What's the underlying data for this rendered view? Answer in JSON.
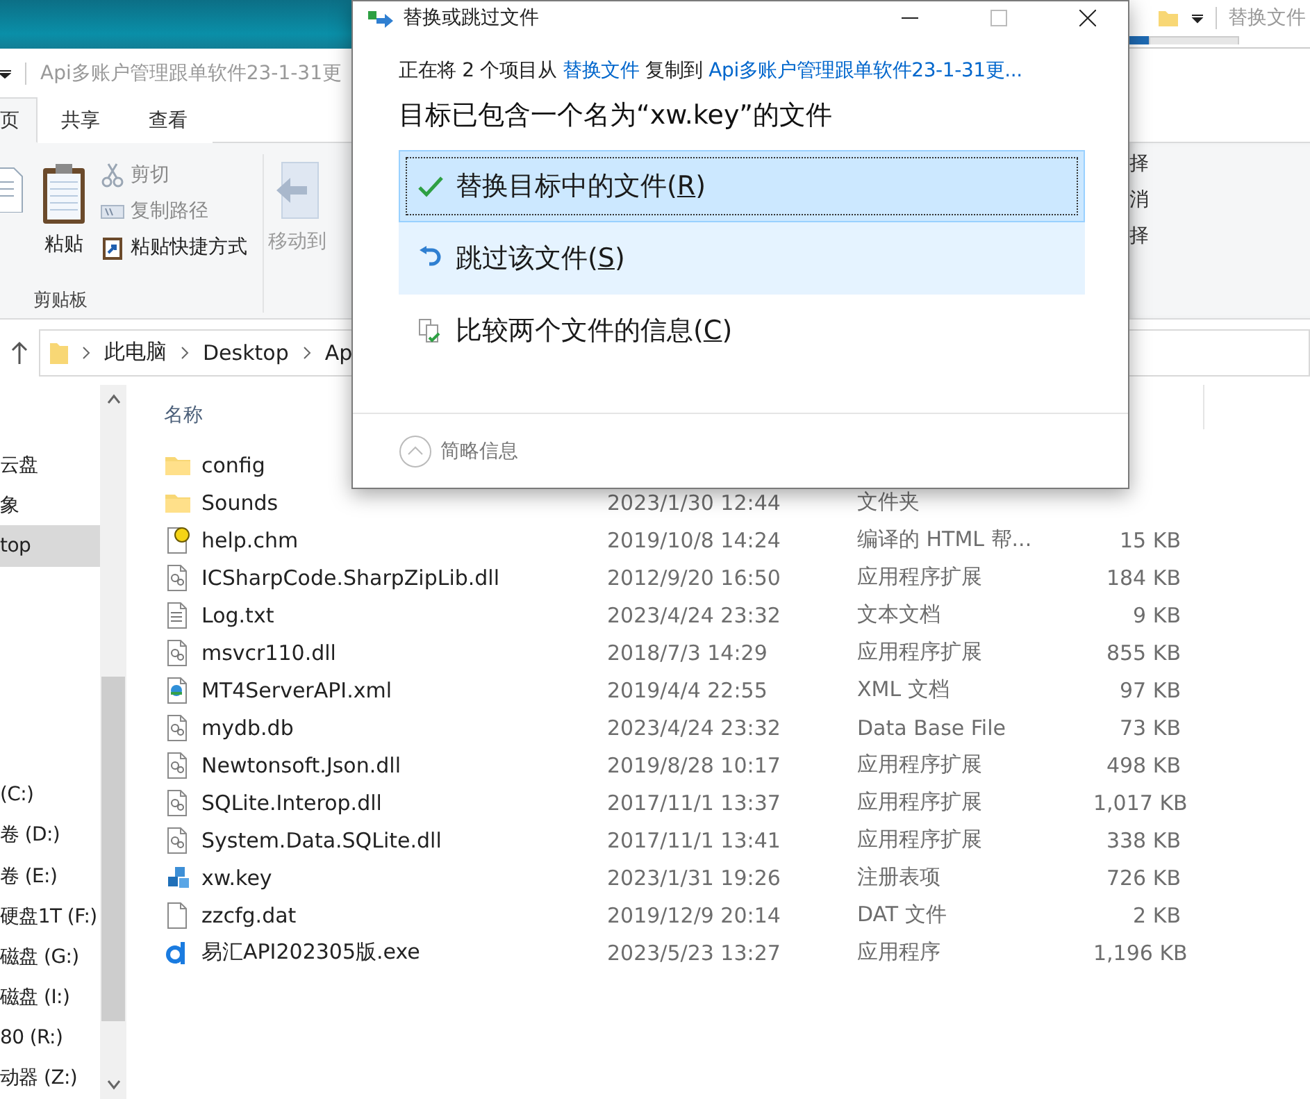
{
  "back_window": {
    "title": "替换文件"
  },
  "explorer": {
    "title": "Api多账户管理跟单软件23-1-31更",
    "tabs": [
      {
        "label": "页",
        "selected": true
      },
      {
        "label": "共享",
        "selected": false
      },
      {
        "label": "查看",
        "selected": false
      }
    ],
    "ribbon": {
      "paste": {
        "label": "粘贴"
      },
      "small_buttons": [
        {
          "kind": "cut",
          "label": "剪切",
          "disabled": true
        },
        {
          "kind": "path",
          "label": "复制路径",
          "disabled": true
        },
        {
          "kind": "shortcut",
          "label": "粘贴快捷方式",
          "disabled": false
        }
      ],
      "group_label": "剪贴板",
      "move_to": {
        "label": "移动到",
        "disabled": true
      },
      "right_labels": [
        "择",
        "消",
        "择"
      ]
    },
    "address": {
      "crumbs": [
        "此电脑",
        "Desktop",
        "Ap"
      ]
    },
    "nav": [
      {
        "label": "云盘",
        "selected": false
      },
      {
        "label": "象",
        "selected": false
      },
      {
        "label": "top",
        "selected": true
      },
      {
        "label": "(C:)",
        "selected": false
      },
      {
        "label": "卷 (D:)",
        "selected": false
      },
      {
        "label": "卷 (E:)",
        "selected": false
      },
      {
        "label": "硬盘1T (F:)",
        "selected": false
      },
      {
        "label": "磁盘 (G:)",
        "selected": false
      },
      {
        "label": "磁盘 (I:)",
        "selected": false
      },
      {
        "label": "80 (R:)",
        "selected": false
      },
      {
        "label": "动器 (Z:)",
        "selected": false
      }
    ],
    "list": {
      "columns": [
        "名称"
      ],
      "rows": [
        {
          "kind": "folder",
          "name": "config"
        },
        {
          "kind": "folder",
          "name": "Sounds",
          "date": "2023/1/30 12:44",
          "type": "文件夹"
        },
        {
          "kind": "help",
          "name": "help.chm",
          "date": "2019/10/8 14:24",
          "type": "编译的 HTML 帮...",
          "size": "15 KB"
        },
        {
          "kind": "dll",
          "name": "ICSharpCode.SharpZipLib.dll",
          "date": "2012/9/20 16:50",
          "type": "应用程序扩展",
          "size": "184 KB"
        },
        {
          "kind": "text",
          "name": "Log.txt",
          "date": "2023/4/24 23:32",
          "type": "文本文档",
          "size": "9 KB"
        },
        {
          "kind": "dll",
          "name": "msvcr110.dll",
          "date": "2018/7/3 14:29",
          "type": "应用程序扩展",
          "size": "855 KB"
        },
        {
          "kind": "xml",
          "name": "MT4ServerAPI.xml",
          "date": "2019/4/4 22:55",
          "type": "XML 文档",
          "size": "97 KB"
        },
        {
          "kind": "dll",
          "name": "mydb.db",
          "date": "2023/4/24 23:32",
          "type": "Data Base File",
          "size": "73 KB"
        },
        {
          "kind": "dll",
          "name": "Newtonsoft.Json.dll",
          "date": "2019/8/28 10:17",
          "type": "应用程序扩展",
          "size": "498 KB"
        },
        {
          "kind": "dll",
          "name": "SQLite.Interop.dll",
          "date": "2017/11/1 13:37",
          "type": "应用程序扩展",
          "size": "1,017 KB"
        },
        {
          "kind": "dll",
          "name": "System.Data.SQLite.dll",
          "date": "2017/11/1 13:41",
          "type": "应用程序扩展",
          "size": "338 KB"
        },
        {
          "kind": "registry",
          "name": "xw.key",
          "date": "2023/1/31 19:26",
          "type": "注册表项",
          "size": "726 KB"
        },
        {
          "kind": "file",
          "name": "zzcfg.dat",
          "date": "2019/12/9 20:14",
          "type": "DAT 文件",
          "size": "2 KB"
        },
        {
          "kind": "app",
          "name": "易汇API202305版.exe",
          "date": "2023/5/23 13:27",
          "type": "应用程序",
          "size": "1,196 KB"
        }
      ]
    }
  },
  "dialog": {
    "title": "替换或跳过文件",
    "summary": {
      "before": "正在将 2 个项目从 ",
      "source": "替换文件",
      "middle": " 复制到 ",
      "target": "Api多账户管理跟单软件23-1-31更..."
    },
    "heading": "目标已包含一个名为“xw.key”的文件",
    "options": [
      {
        "kind": "replace",
        "label_before": "替换目标中的文件(",
        "access_key": "R",
        "label_after": ")",
        "selected": true,
        "hovered": false
      },
      {
        "kind": "skip",
        "label_before": "跳过该文件(",
        "access_key": "S",
        "label_after": ")",
        "selected": false,
        "hovered": true
      },
      {
        "kind": "compare",
        "label_before": "比较两个文件的信息(",
        "access_key": "C",
        "label_after": ")",
        "selected": false,
        "hovered": false
      }
    ],
    "details_toggle": "简略信息"
  }
}
